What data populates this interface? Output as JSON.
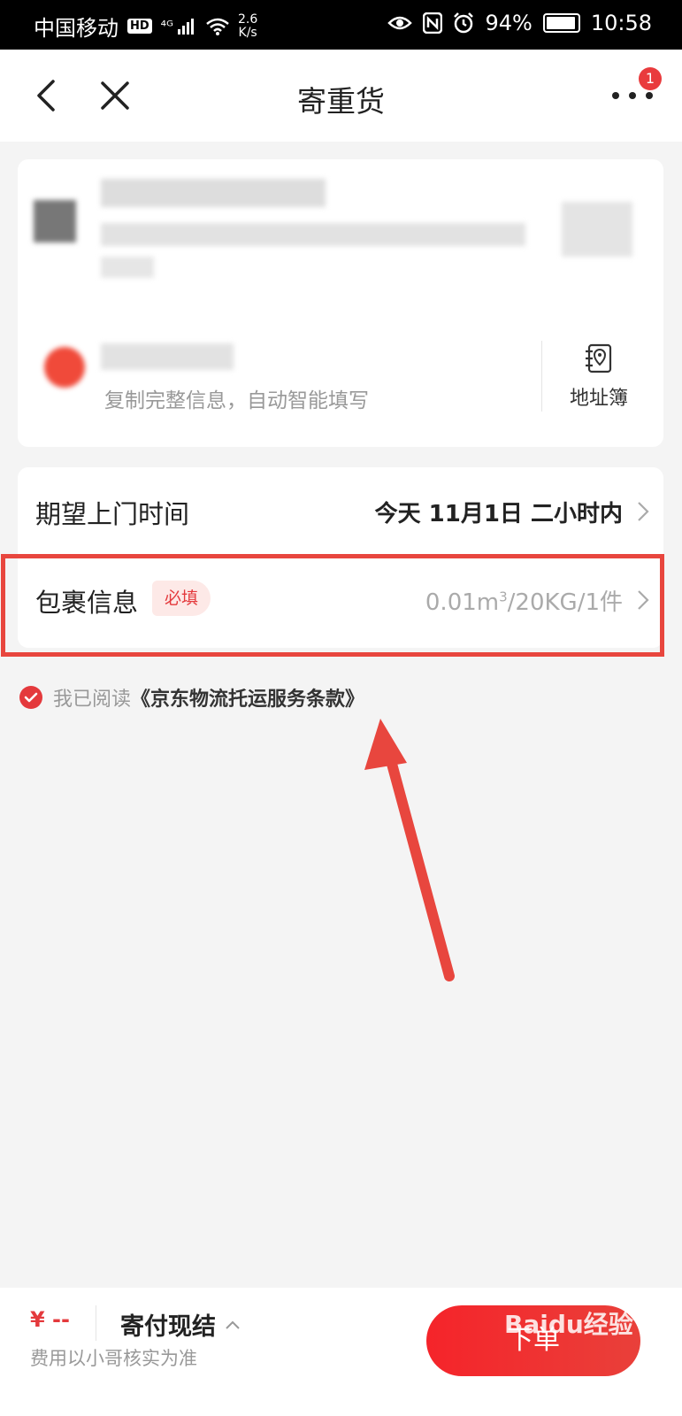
{
  "statusbar": {
    "carrier": "中国移动",
    "hd": "HD",
    "signal": "⁴ᴳ",
    "speed_value": "2.6",
    "speed_unit": "K/s",
    "battery": "94%",
    "time": "10:58"
  },
  "navbar": {
    "title": "寄重货",
    "badge_count": "1"
  },
  "address": {
    "hint": "复制完整信息，自动智能填写",
    "book_label": "地址簿"
  },
  "options": {
    "pickup_label": "期望上门时间",
    "pickup_value": "今天 11月1日 二小时内",
    "package_label": "包裹信息",
    "package_required": "必填",
    "package_value_pre": "0.01m",
    "package_value_sup": "3",
    "package_value_post": "/20KG/1件"
  },
  "agreement": {
    "prefix": "我已阅读",
    "link": "《京东物流托运服务条款》"
  },
  "bottom": {
    "price": "¥ --",
    "fee_note": "费用以小哥核实为准",
    "pay_method": "寄付现结",
    "order_button": "下单",
    "watermark": "Baidu经验"
  },
  "colors": {
    "accent": "#e4393c",
    "highlight": "#e8463e"
  }
}
